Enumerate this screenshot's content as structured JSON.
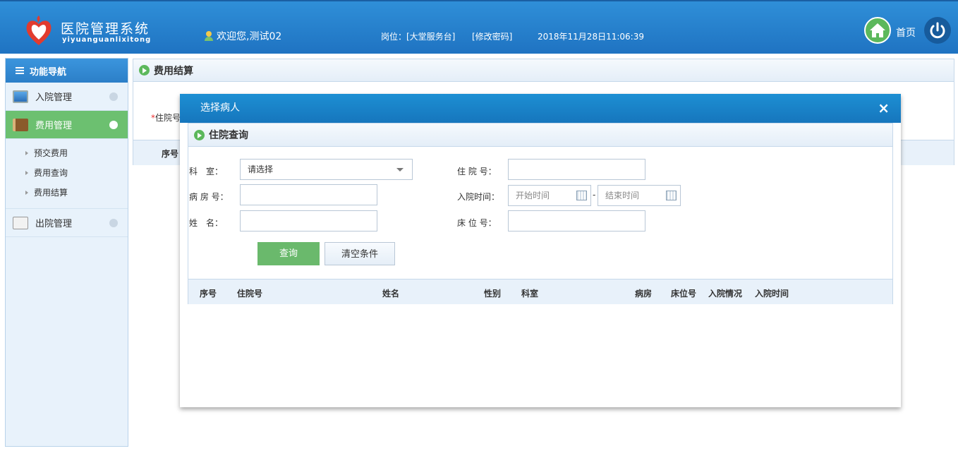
{
  "header": {
    "logo_title": "医院管理系统",
    "logo_sub": "yiyuanguanlixitong",
    "welcome": "欢迎您,测试02",
    "post": "岗位：[大堂服务台]",
    "change_password": "[修改密码]",
    "datetime": "2018年11月28日11:06:39",
    "home_label": "首页"
  },
  "sidebar": {
    "title": "功能导航",
    "items": [
      {
        "label": "入院管理"
      },
      {
        "label": "费用管理"
      },
      {
        "label": "出院管理"
      }
    ],
    "sub_items": [
      {
        "label": "预交费用"
      },
      {
        "label": "费用查询"
      },
      {
        "label": "费用结算"
      }
    ]
  },
  "main": {
    "title": "费用结算",
    "zyh_label": "住院号",
    "required_mark": "*",
    "col_seq": "序号"
  },
  "modal": {
    "title": "选择病人",
    "close": "×",
    "panel_title": "住院查询",
    "labels": {
      "dept": "科　室：",
      "zyh": "住 院 号：",
      "ward": "病 房 号：",
      "admit_time": "入院时间：",
      "name": "姓　名：",
      "bed": "床 位 号："
    },
    "dept_select": "请选择",
    "start_placeholder": "开始时间",
    "end_placeholder": "结束时间",
    "dash": "-",
    "query_button": "查询",
    "clear_button": "清空条件",
    "columns": [
      "序号",
      "住院号",
      "姓名",
      "性别",
      "科室",
      "病房",
      "床位号",
      "入院情况",
      "入院时间"
    ]
  },
  "colors": {
    "header_blue": "#2f8fd8",
    "active_green": "#6cc070",
    "modal_head": "#1d8fd3"
  }
}
